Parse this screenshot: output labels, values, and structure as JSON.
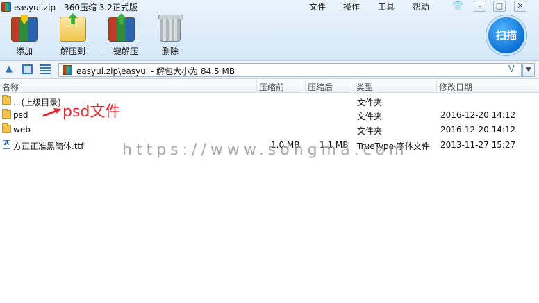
{
  "window": {
    "title": "easyui.zip - 360压缩 3.2正式版",
    "menu": [
      "文件",
      "操作",
      "工具",
      "帮助"
    ]
  },
  "toolbar": {
    "add_label": "添加",
    "extract_label": "解压到",
    "onekey_label": "一键解压",
    "delete_label": "删除",
    "scan_label": "扫描"
  },
  "address": {
    "path_text": "easyui.zip\\easyui - 解包大小为 84.5 MB",
    "v_glyph": "V"
  },
  "columns": {
    "name": "名称",
    "compressed": "压缩前",
    "after": "压缩后",
    "type": "类型",
    "modified": "修改日期"
  },
  "rows": [
    {
      "name": ".. (上级目录)",
      "compressed": "",
      "after": "",
      "type": "文件夹",
      "modified": "",
      "icon": "folder-icon"
    },
    {
      "name": "psd",
      "compressed": "",
      "after": "",
      "type": "文件夹",
      "modified": "2016-12-20 14:12",
      "icon": "folder-icon"
    },
    {
      "name": "web",
      "compressed": "",
      "after": "",
      "type": "文件夹",
      "modified": "2016-12-20 14:12",
      "icon": "folder-icon"
    },
    {
      "name": "方正正准黑简体.ttf",
      "compressed": "1.0 MB",
      "after": "1.1 MB",
      "type": "TrueType 字体文件",
      "modified": "2013-11-27 15:27",
      "icon": "font-file-icon"
    }
  ],
  "annotation": {
    "label": "psd文件",
    "color": "#e8242c"
  },
  "watermark": "https://www.songma.com",
  "colors": {
    "accent": "#2e74c0",
    "scan_button": "#0b6fd4"
  }
}
